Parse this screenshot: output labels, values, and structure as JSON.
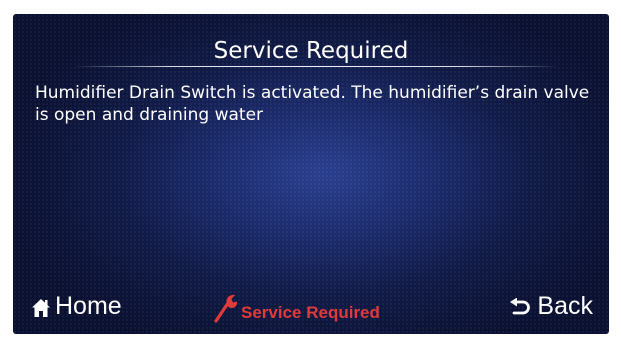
{
  "header": {
    "title": "Service Required"
  },
  "main": {
    "message": "Humidifier Drain Switch is activated. The humidifier’s drain valve is open and draining water"
  },
  "footer": {
    "home": {
      "label": "Home",
      "icon": "home-icon"
    },
    "service": {
      "label": "Service Required",
      "icon": "wrench-icon",
      "color": "#e03a3a"
    },
    "back": {
      "label": "Back",
      "icon": "back-arrow-icon"
    }
  },
  "colors": {
    "background": "#1b2a6a",
    "text": "#ffffff",
    "alert": "#e03a3a"
  }
}
